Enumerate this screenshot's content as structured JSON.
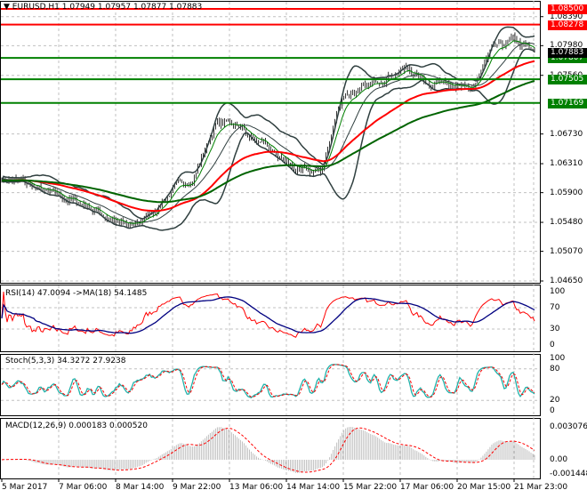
{
  "header": {
    "symbol": "EURUSD,H1",
    "ohlc": "1.07949 1.07957 1.07877 1.07883"
  },
  "price_axis": [
    "1.08390",
    "1.07980",
    "1.07560",
    "1.06730",
    "1.06310",
    "1.05900",
    "1.05480",
    "1.05070",
    "1.04650"
  ],
  "levels": [
    {
      "price": 1.085,
      "label": "1.08500",
      "color": "#ff0000"
    },
    {
      "price": 1.08278,
      "label": "1.08278",
      "color": "#ff0000"
    },
    {
      "price": 1.07807,
      "label": "1.07807",
      "color": "#008000"
    },
    {
      "price": 1.07505,
      "label": "1.07505",
      "color": "#008000"
    },
    {
      "price": 1.07169,
      "label": "1.07169",
      "color": "#008000"
    }
  ],
  "current_price": {
    "price": 1.07883,
    "label": "1.07883"
  },
  "rsi": {
    "title": "RSI(14) 47.0094  ->MA(18) 54.1485",
    "axis": [
      "100",
      "70",
      "30",
      "0"
    ]
  },
  "stoch": {
    "title": "Stoch(5,3,3) 34.3272 27.9238",
    "axis": [
      "100",
      "80",
      "20",
      "0"
    ]
  },
  "macd": {
    "title": "MACD(12,26,9) 0.000183 0.000520",
    "axis": [
      "0.003076",
      "0.00",
      "-0.001448"
    ]
  },
  "time_axis": [
    "5 Mar 2017",
    "7 Mar 06:00",
    "8 Mar 14:00",
    "9 Mar 22:00",
    "13 Mar 06:00",
    "14 Mar 14:00",
    "15 Mar 22:00",
    "17 Mar 06:00",
    "20 Mar 15:00",
    "21 Mar 23:00"
  ],
  "chart_data": {
    "type": "candlestick",
    "symbol": "EURUSD",
    "timeframe": "H1",
    "ylim": [
      1.0465,
      1.085
    ],
    "close_approx": [
      1.0611,
      1.0605,
      1.059,
      1.0582,
      1.0572,
      1.0555,
      1.054,
      1.056,
      1.0594,
      1.0611,
      1.0686,
      1.069,
      1.066,
      1.064,
      1.0618,
      1.062,
      1.073,
      1.0735,
      1.0755,
      1.0765,
      1.0745,
      1.075,
      1.073,
      1.079,
      1.0805,
      1.0788
    ],
    "colors": {
      "bands": "#2f3f3f",
      "ma_fast": "#008000",
      "ma_slow_red": "#ff0000",
      "ma_slow_green": "#006400",
      "rsi": "#ff0000",
      "rsi_ma": "#000080",
      "stoch_main": "#20b2aa",
      "stoch_signal": "#ff0000",
      "macd_hist": "#c0c0c0",
      "macd_signal": "#ff0000"
    }
  }
}
